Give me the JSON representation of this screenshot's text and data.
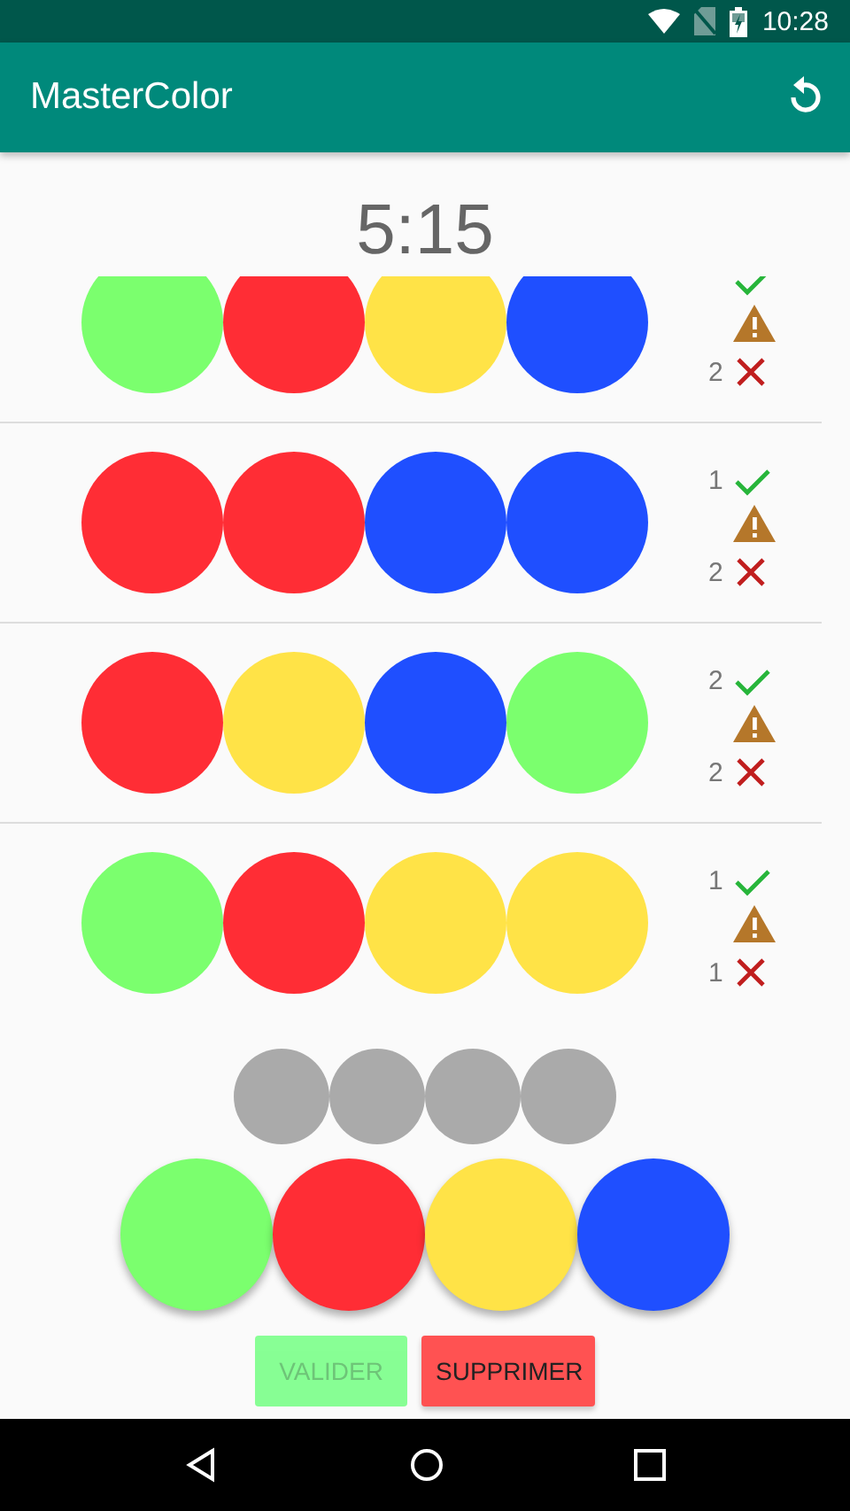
{
  "status_bar": {
    "time": "10:28"
  },
  "app_bar": {
    "title": "MasterColor"
  },
  "timer": "5:15",
  "rows": [
    {
      "pegs": [
        {
          "color": "#7bff6e"
        },
        {
          "color": "#ff2d35"
        },
        {
          "color": "#ffe347"
        },
        {
          "color": "#1f4fff"
        }
      ],
      "wrong": "2"
    },
    {
      "pegs": [
        {
          "color": "#ff2d35"
        },
        {
          "color": "#ff2d35"
        },
        {
          "color": "#1f4fff"
        },
        {
          "color": "#1f4fff"
        }
      ],
      "correct": "1",
      "wrong": "2"
    },
    {
      "pegs": [
        {
          "color": "#ff2d35"
        },
        {
          "color": "#ffe347"
        },
        {
          "color": "#1f4fff"
        },
        {
          "color": "#7bff6e"
        }
      ],
      "correct": "2",
      "wrong": "2"
    },
    {
      "pegs": [
        {
          "color": "#7bff6e"
        },
        {
          "color": "#ff2d35"
        },
        {
          "color": "#ffe347"
        },
        {
          "color": "#ffe347"
        }
      ],
      "correct": "1",
      "wrong": "1"
    }
  ],
  "guess": [
    {
      "color": "#aaaaaa"
    },
    {
      "color": "#aaaaaa"
    },
    {
      "color": "#aaaaaa"
    },
    {
      "color": "#aaaaaa"
    }
  ],
  "palette": [
    {
      "color": "#7bff6e"
    },
    {
      "color": "#ff2d35"
    },
    {
      "color": "#ffe347"
    },
    {
      "color": "#1f4fff"
    }
  ],
  "buttons": [
    {
      "label": "VALIDER",
      "kind": "validate",
      "disabled": true
    },
    {
      "label": "SUPPRIMER",
      "kind": "delete",
      "disabled": false
    }
  ]
}
